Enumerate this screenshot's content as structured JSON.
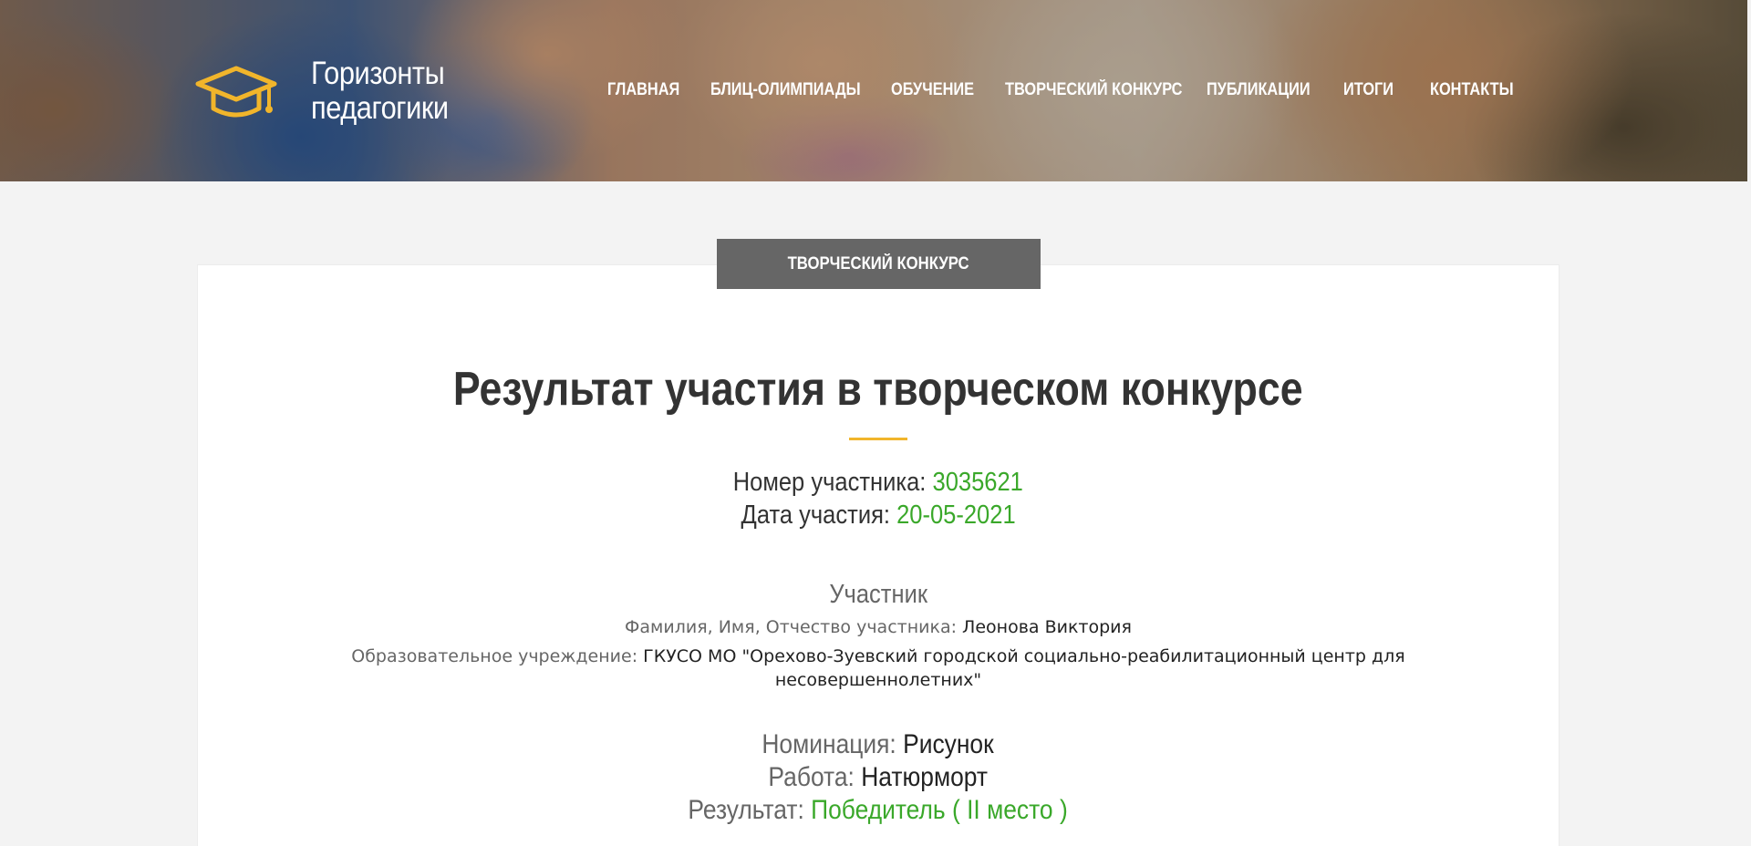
{
  "brand": {
    "name_line1": "Горизонты",
    "name_line2": "педагогики",
    "icon": "graduation-cap-icon",
    "accent_color": "#f1b52b"
  },
  "nav": {
    "items": [
      {
        "label": "ГЛАВНАЯ"
      },
      {
        "label": "БЛИЦ-ОЛИМПИАДЫ"
      },
      {
        "label": "ОБУЧЕНИЕ"
      },
      {
        "label": "ТВОРЧЕСКИЙ КОНКУРС"
      },
      {
        "label": "ПУБЛИКАЦИИ"
      },
      {
        "label": "ИТОГИ"
      },
      {
        "label": "КОНТАКТЫ"
      }
    ]
  },
  "category_badge": "ТВОРЧЕСКИЙ КОНКУРС",
  "page": {
    "title": "Результат участия в творческом конкурсе",
    "participant_number_label": "Номер участника:",
    "participant_number": "3035621",
    "participation_date_label": "Дата участия:",
    "participation_date": "20-05-2021"
  },
  "participant": {
    "heading": "Участник",
    "fio_label": "Фамилия, Имя, Отчество участника:",
    "fio_value": "Леонова Виктория",
    "institution_label": "Образовательное учреждение:",
    "institution_value_line1": "ГКУСО МО \"Орехово-Зуевский городской социально-реабилитационный центр для",
    "institution_value_line2": "несовершеннолетних\""
  },
  "work": {
    "nomination_label": "Номинация:",
    "nomination_value": "Рисунок",
    "work_label": "Работа:",
    "work_value": "Натюрморт",
    "result_label": "Результат:",
    "result_value": "Победитель ( II место )"
  },
  "colors": {
    "green": "#3aa82a",
    "badge_bg": "#666666",
    "page_bg": "#f3f3f3"
  }
}
